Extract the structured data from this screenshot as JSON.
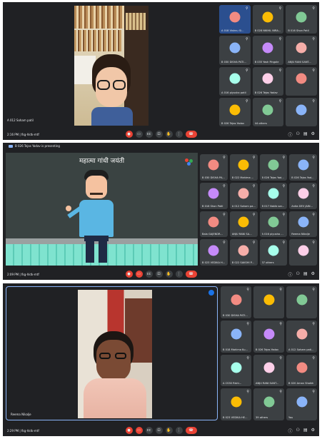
{
  "panel1": {
    "main_label": "A 012 Soham patil",
    "time_meeting": "2:16 PM | fkg-hktk-mtf",
    "tiles": [
      {
        "name": "A 018 Vishnu Si...",
        "color": "#1a73e8"
      },
      {
        "name": "B 028 NIKHIL NIRA...",
        "color": "#5f6368"
      },
      {
        "name": "B 016 Shon Patil",
        "color": "#5f6368"
      },
      {
        "name": "B 030 DISHA PATI...",
        "color": "#5f6368"
      },
      {
        "name": "B 035 Yash Pingale",
        "color": "#5f6368"
      },
      {
        "name": "ANJU RANI SANT...",
        "color": "#5f6368"
      },
      {
        "name": "A 016 piyusha patil",
        "color": "#5f6368"
      },
      {
        "name": "B 026 Tejas Yadav",
        "color": "#5f6368"
      },
      {
        "name": "",
        "color": "#5f6368"
      },
      {
        "name": "B 026 Tejas Yadav",
        "color": "#5f6368"
      },
      {
        "name": "44 others",
        "color": "#5f6368"
      },
      {
        "name": "",
        "color": "#5f6368"
      }
    ]
  },
  "panel2": {
    "presenting": "B 026 Tejas Yadav is presenting",
    "slide_title": "महात्मा गांधी जयंती",
    "time_meeting": "2:09 PM | fkg-hktk-mtf",
    "tiles": [
      {
        "name": "B 030 DISHA PA..."
      },
      {
        "name": "B 022 Mahima ..."
      },
      {
        "name": "B 026 Tejas Yad..."
      },
      {
        "name": "B 026 Tejas Yad..."
      },
      {
        "name": "B 016 Shon Patil"
      },
      {
        "name": "A 012 Soham pa..."
      },
      {
        "name": "B 017 Nakib sar..."
      },
      {
        "name": "Anita DEV JAIN..."
      },
      {
        "name": "Bala GAJENDR..."
      },
      {
        "name": "ANJU RANI SA..."
      },
      {
        "name": "A 016 piyusha ..."
      },
      {
        "name": "Reema Nikalje"
      },
      {
        "name": "B 023 VEDIKA H..."
      },
      {
        "name": "B 022 SAKSHI P..."
      },
      {
        "name": "37 others"
      },
      {
        "name": ""
      }
    ]
  },
  "panel3": {
    "main_label": "Reema Nikalje",
    "time_meeting": "2:29 PM | fkg-hktk-mtf",
    "tiles": [
      {
        "name": "B 030 DISHA PATI..."
      },
      {
        "name": ""
      },
      {
        "name": ""
      },
      {
        "name": "B 018 Mahima Ku..."
      },
      {
        "name": "B 026 Tejas Yadav"
      },
      {
        "name": "A 012 Soham pati..."
      },
      {
        "name": "A CS30 Rishi..."
      },
      {
        "name": "ANJU RANI SANT..."
      },
      {
        "name": "B 020 Aman Shaikh"
      },
      {
        "name": "B 023 VEDIKA HE..."
      },
      {
        "name": "39 others"
      },
      {
        "name": "You"
      }
    ]
  }
}
